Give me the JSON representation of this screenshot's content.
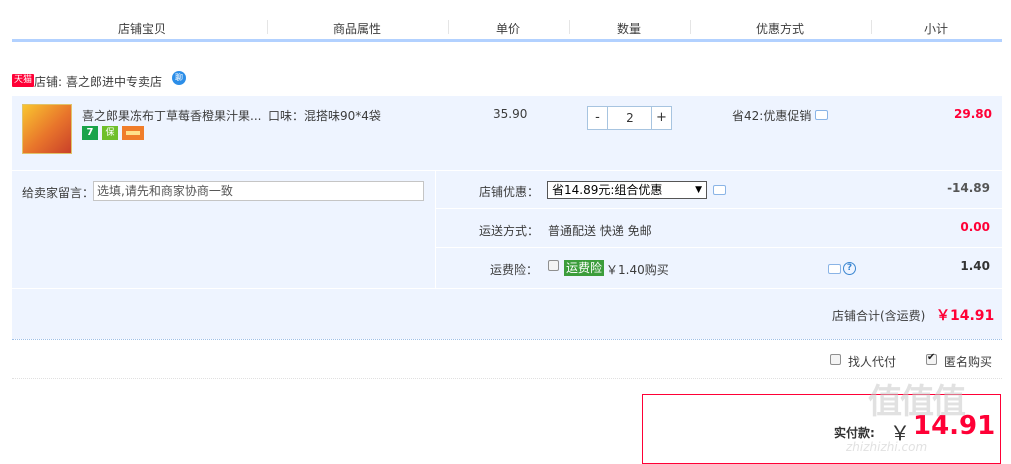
{
  "header": {
    "columns": [
      "店铺宝贝",
      "商品属性",
      "单价",
      "数量",
      "优惠方式",
      "小计"
    ]
  },
  "shop": {
    "badge": "天猫",
    "label": "店铺:",
    "name": "喜之郎进中专卖店",
    "ww_text": "聊"
  },
  "item": {
    "title": "喜之郎果冻布丁草莓香橙果汁果...",
    "attr": "口味：混搭味90*4袋",
    "price": "35.90",
    "quantity": "2",
    "minus": "-",
    "plus": "+",
    "promo": "省42:优惠促销",
    "subtotal": "29.80",
    "icon7": "7",
    "iconB": "保"
  },
  "extras": {
    "message_label": "给卖家留言：",
    "message_placeholder": "选填,请先和商家协商一致",
    "shop_discount_label": "店铺优惠：",
    "shop_discount_value": "省14.89元:组合优惠",
    "shop_discount_amount": "-14.89",
    "shipping_label": "运送方式：",
    "shipping_value": "普通配送 快递 免邮",
    "shipping_amount": "0.00",
    "insurance_label": "运费险：",
    "insurance_tag": "运费险",
    "insurance_value": "￥1.40购买",
    "insurance_amount": "1.40",
    "help_icon": "?"
  },
  "shop_total": {
    "label": "店铺合计(含运费)",
    "value": "￥14.91"
  },
  "options": {
    "proxy_label": "找人代付",
    "anonymous_label": "匿名购买",
    "anonymous_checked": true
  },
  "payment": {
    "label": "实付款:",
    "currency": "￥",
    "amount": "14.91"
  },
  "watermark": {
    "logo": "值值值",
    "url": "zhizhizhi.com"
  },
  "colors": {
    "accent": "#ff0036",
    "header_border": "#b2d1ff",
    "row_bg": "#eef4ff"
  }
}
